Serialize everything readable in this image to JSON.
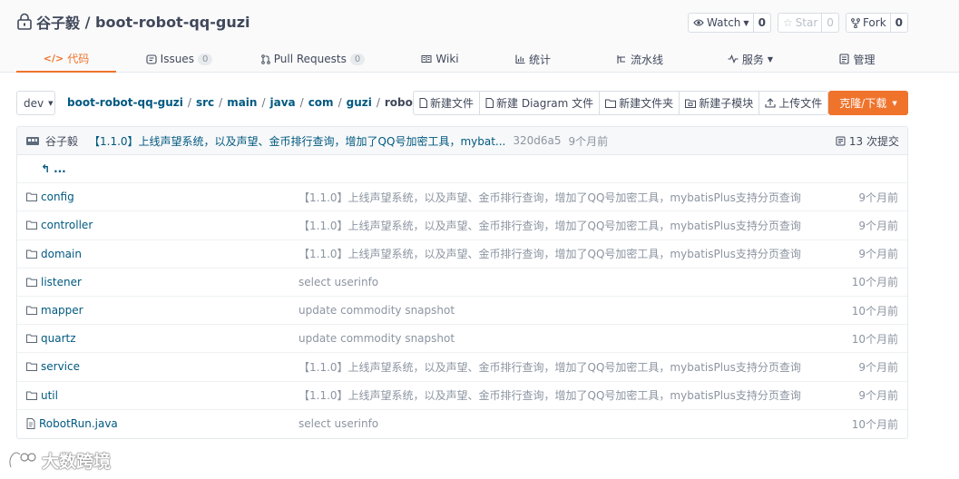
{
  "repo": {
    "owner": "谷子毅",
    "separator": " / ",
    "name": "boot-robot-qq-guzi"
  },
  "actions": {
    "watch": {
      "label": "Watch",
      "count": "0"
    },
    "star": {
      "label": "Star",
      "count": "0"
    },
    "fork": {
      "label": "Fork",
      "count": "0"
    }
  },
  "tabs": [
    {
      "label": "代码",
      "icon": "code-icon"
    },
    {
      "label": "Issues",
      "badge": "0",
      "icon": "issue-icon"
    },
    {
      "label": "Pull Requests",
      "badge": "0",
      "icon": "pull-request-icon"
    },
    {
      "label": "Wiki",
      "icon": "book-icon"
    },
    {
      "label": "统计",
      "icon": "bar-chart-icon"
    },
    {
      "label": "流水线",
      "icon": "pipeline-icon"
    },
    {
      "label": "服务",
      "icon": "pulse-icon"
    },
    {
      "label": "管理",
      "icon": "settings-doc-icon"
    }
  ],
  "branch": {
    "name": "dev"
  },
  "breadcrumb": {
    "repo": "boot-robot-qq-guzi",
    "parts": [
      "src",
      "main",
      "java",
      "com",
      "guzi"
    ],
    "current": "robot"
  },
  "toolbar": {
    "new_file": "新建文件",
    "new_diagram": "新建 Diagram 文件",
    "new_folder": "新建文件夹",
    "new_submodule": "新建子模块",
    "upload": "上传文件",
    "clone": "克隆/下载"
  },
  "latest_commit": {
    "author": "谷子毅",
    "message": "【1.1.0】上线声望系统，以及声望、金币排行查询，增加了QQ号加密工具，mybat...",
    "sha": "320d6a5",
    "time": "9个月前",
    "commits": "13 次提交"
  },
  "up_link": "...",
  "files": [
    {
      "name": "config",
      "type": "folder",
      "message": "【1.1.0】上线声望系统，以及声望、金币排行查询，增加了QQ号加密工具，mybatisPlus支持分页查询",
      "time": "9个月前"
    },
    {
      "name": "controller",
      "type": "folder",
      "message": "【1.1.0】上线声望系统，以及声望、金币排行查询，增加了QQ号加密工具，mybatisPlus支持分页查询",
      "time": "9个月前"
    },
    {
      "name": "domain",
      "type": "folder",
      "message": "【1.1.0】上线声望系统，以及声望、金币排行查询，增加了QQ号加密工具，mybatisPlus支持分页查询",
      "time": "9个月前"
    },
    {
      "name": "listener",
      "type": "folder",
      "message": "select userinfo",
      "time": "10个月前"
    },
    {
      "name": "mapper",
      "type": "folder",
      "message": "update commodity snapshot",
      "time": "10个月前"
    },
    {
      "name": "quartz",
      "type": "folder",
      "message": "update commodity snapshot",
      "time": "10个月前"
    },
    {
      "name": "service",
      "type": "folder",
      "message": "【1.1.0】上线声望系统，以及声望、金币排行查询，增加了QQ号加密工具，mybatisPlus支持分页查询",
      "time": "9个月前"
    },
    {
      "name": "util",
      "type": "folder",
      "message": "【1.1.0】上线声望系统，以及声望、金币排行查询，增加了QQ号加密工具，mybatisPlus支持分页查询",
      "time": "9个月前"
    },
    {
      "name": "RobotRun.java",
      "type": "file",
      "message": "select userinfo",
      "time": "10个月前"
    }
  ],
  "watermark": {
    "text": "大数跨境"
  },
  "colors": {
    "accent": "#f0732c",
    "link": "#005980",
    "muted": "#8c95a1",
    "text": "#40485b"
  }
}
